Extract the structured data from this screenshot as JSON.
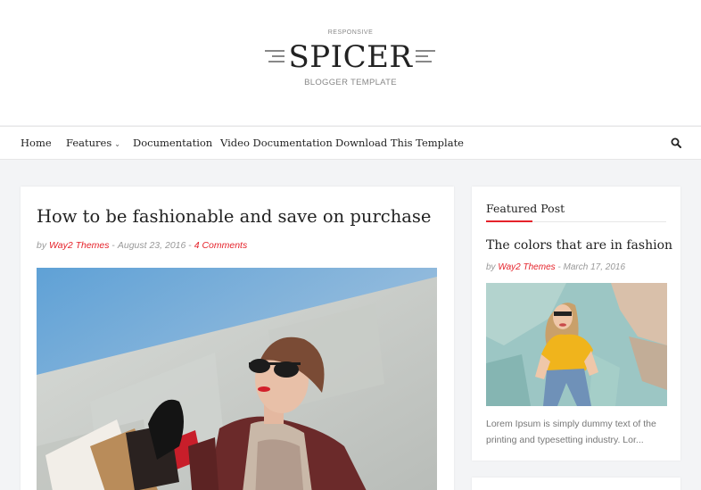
{
  "header": {
    "tagline": "RESPONSIVE",
    "title": "SPICER",
    "subtitle": "BLOGGER TEMPLATE"
  },
  "nav": {
    "items": [
      {
        "label": "Home"
      },
      {
        "label": "Features",
        "has_dropdown": true
      },
      {
        "label": "Documentation"
      },
      {
        "label": "Video Documentation"
      },
      {
        "label": "Download This Template"
      }
    ],
    "search_icon": "search-icon"
  },
  "post": {
    "title": "How to be fashionable and save on purchase",
    "by": "by",
    "author": "Way2 Themes",
    "sep1": " - ",
    "date": "August 23, 2016",
    "sep2": " - ",
    "comments": "4 Comments"
  },
  "sidebar": {
    "widget_title": "Featured Post",
    "featured": {
      "title": "The colors that are in fashion",
      "by": "by",
      "author": "Way2 Themes",
      "sep": " - ",
      "date": "March 17, 2016",
      "excerpt": "Lorem Ipsum is simply dummy text of the printing and typesetting industry. Lor..."
    }
  },
  "colors": {
    "accent": "#e5232b",
    "background": "#f3f4f6"
  }
}
